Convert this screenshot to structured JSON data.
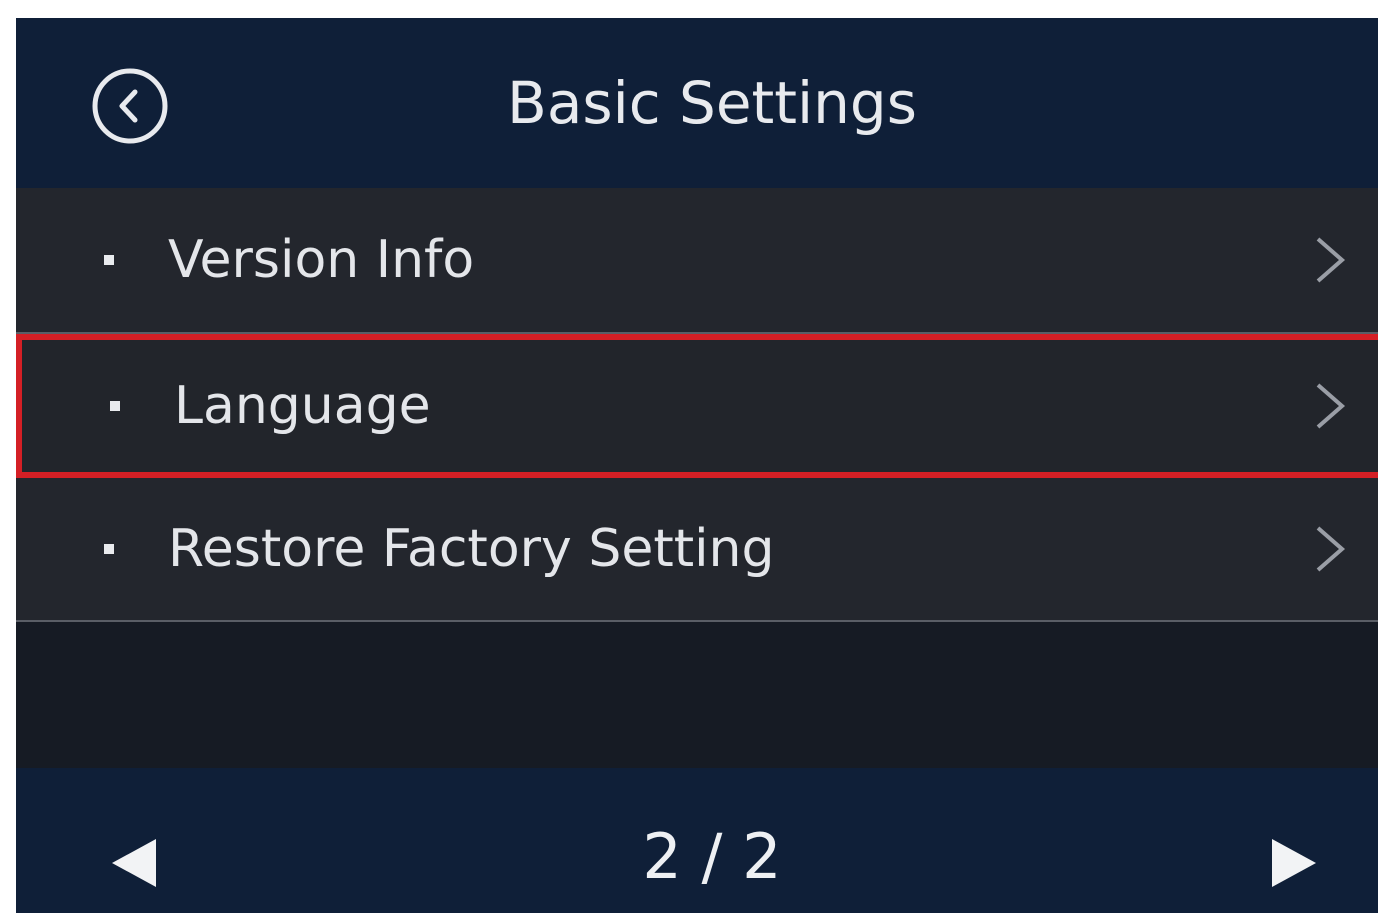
{
  "header": {
    "title": "Basic Settings",
    "back_icon": "circle-chevron-left-icon"
  },
  "menu": {
    "items": [
      {
        "label": "Version Info",
        "selected": false
      },
      {
        "label": "Language",
        "selected": true
      },
      {
        "label": "Restore Factory Setting",
        "selected": false
      }
    ]
  },
  "pager": {
    "indicator": "2 / 2",
    "current_page": 2,
    "total_pages": 2
  },
  "colors": {
    "header_bg": "#0f1f38",
    "row_bg": "#23262d",
    "selection_border": "#d41f25"
  }
}
